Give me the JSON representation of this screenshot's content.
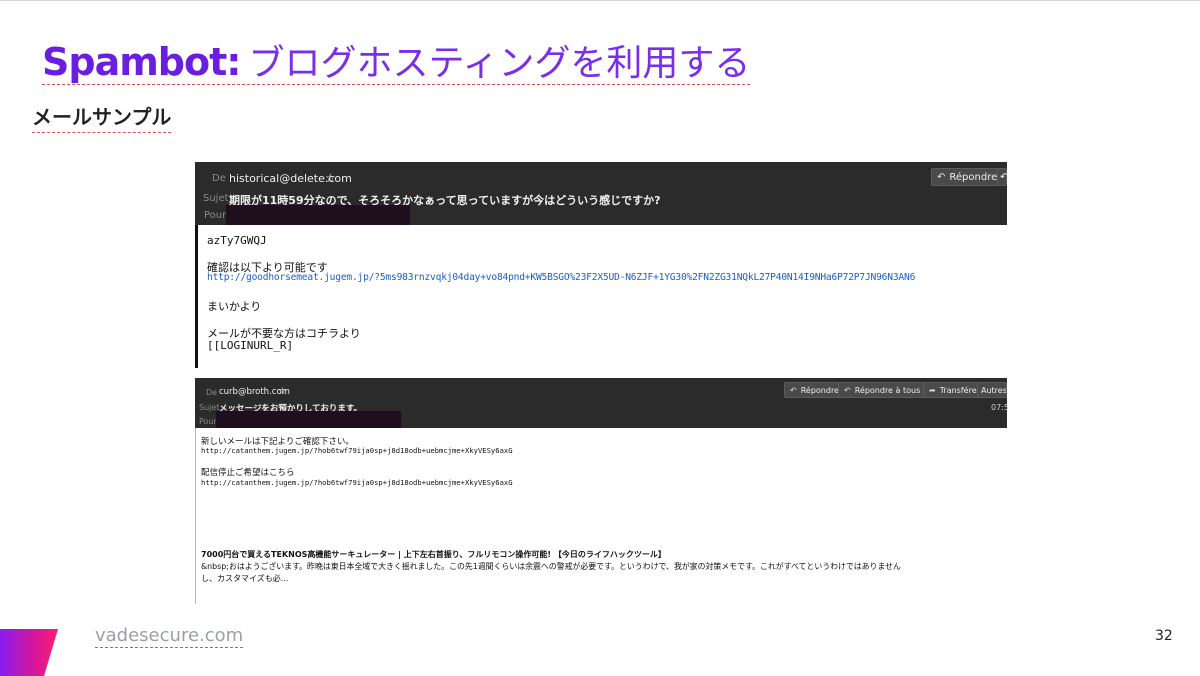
{
  "slide": {
    "title_brand": "Spambot:",
    "title_jp": "ブログホスティングを利用する",
    "subtitle": "メールサンプル",
    "footer_url": "vadesecure.com",
    "page_number": "32",
    "colors": {
      "brand_purple": "#6a1fe0",
      "header_dark": "#2b2b2b",
      "link_blue": "#1a5fc8"
    }
  },
  "email1": {
    "from_label": "De",
    "from": "historical@delete.com",
    "subject_label": "Sujet",
    "subject": "期限が11時59分なので、そろそろかなぁって思っていますが今はどういう感じですか?",
    "to_label": "Pour",
    "reply_button": "Répondre",
    "body": {
      "line1": "azTy7GWQJ",
      "line2": "確認は以下より可能です",
      "link": "http://goodhorsemeat.jugem.jp/?5ms983rnzvqkj04day+vo84pnd+KW5BSGO%23F2X5UD-N6ZJF+1YG30%2FN2ZG31NQkL27P40N14I9NHa6P72P7JN96N3AN6",
      "line3": "まいかより",
      "line4": "メールが不要な方はコチラより",
      "line5": "[[LOGINURL_R]"
    }
  },
  "email2": {
    "from_label": "De",
    "from": "curb@broth.com",
    "subject_label": "Sujet",
    "subject": "メッセージをお預かりしております。",
    "to_label": "Pour",
    "buttons": {
      "reply": "Répondre",
      "reply_all": "Répondre à tous",
      "forward": "Transférer",
      "more": "Autres"
    },
    "time": "07:5",
    "body": {
      "line1": "新しいメールは下記よりご確認下さい。",
      "link1": "http://catanthem.jugem.jp/?hob6twf79ija0sp+j8d18odb+uebmcjme+XkyVESy6axG",
      "line2": "配信停止ご希望はこちら",
      "link2": "http://catanthem.jugem.jp/?hob6twf79ija0sp+j8d18odb+uebmcjme+XkyVESy6axG",
      "line3": "7000円台で買えるTEKNOS高機能サーキュレーター | 上下左右首振り、フルリモコン操作可能! 【今日のライフハックツール】",
      "line4": "&nbsp;おはようございます。昨晩は東日本全域で大きく揺れました。この先1週間くらいは余震への警戒が必要です。というわけで、我が家の対策メモです。これがすべてというわけではありません",
      "line5": "し、カスタマイズも必..."
    }
  },
  "icons": {
    "star": "star-icon",
    "reply": "reply-icon",
    "reply_all": "reply-all-icon",
    "forward": "forward-icon",
    "chevron": "chevron-down-icon"
  }
}
